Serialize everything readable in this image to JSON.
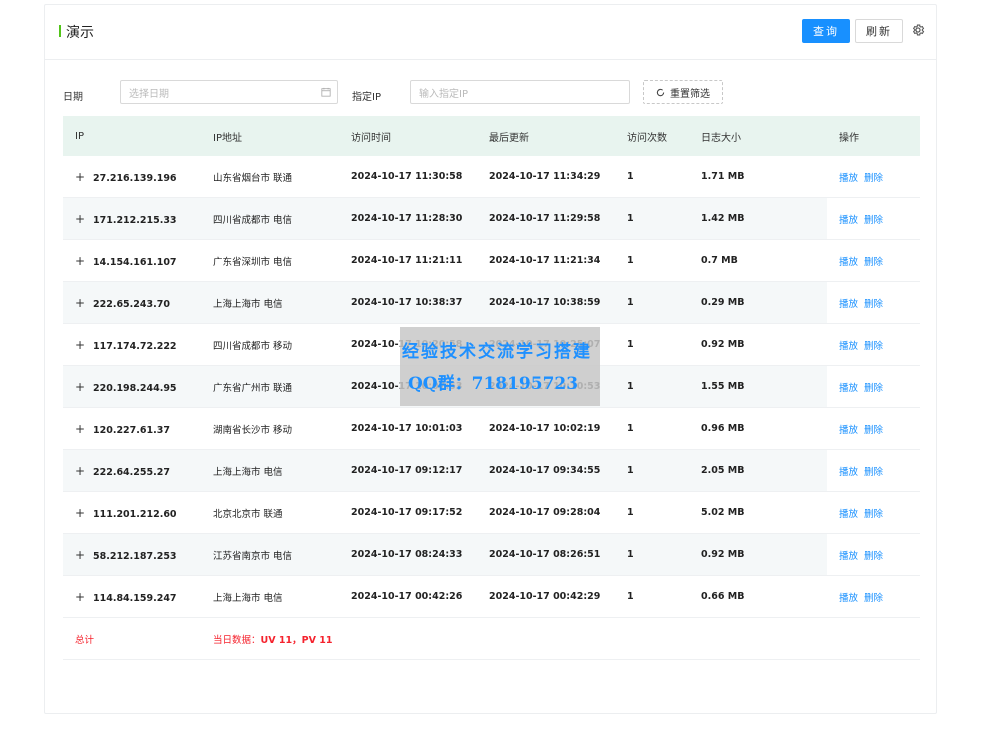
{
  "header": {
    "title": "演示",
    "query_label": "查询",
    "refresh_label": "刷新",
    "settings_icon": "gear-icon",
    "accent_color": "#52c41a",
    "primary_color": "#1890ff"
  },
  "filters": {
    "date_label": "日期",
    "date_placeholder": "选择日期",
    "ip_label": "指定IP",
    "ip_placeholder": "输入指定IP",
    "reset_label": "重置筛选"
  },
  "table": {
    "columns": [
      "IP",
      "IP地址",
      "访问时间",
      "最后更新",
      "访问次数",
      "日志大小",
      "操作"
    ],
    "rows": [
      {
        "ip": "27.216.139.196",
        "location": "山东省烟台市 联通",
        "visit_time": "2024-10-17 11:30:58",
        "last_update": "2024-10-17 11:34:29",
        "count": "1",
        "size": "1.71 MB"
      },
      {
        "ip": "171.212.215.33",
        "location": "四川省成都市 电信",
        "visit_time": "2024-10-17 11:28:30",
        "last_update": "2024-10-17 11:29:58",
        "count": "1",
        "size": "1.42 MB"
      },
      {
        "ip": "14.154.161.107",
        "location": "广东省深圳市 电信",
        "visit_time": "2024-10-17 11:21:11",
        "last_update": "2024-10-17 11:21:34",
        "count": "1",
        "size": "0.7 MB"
      },
      {
        "ip": "222.65.243.70",
        "location": "上海上海市 电信",
        "visit_time": "2024-10-17 10:38:37",
        "last_update": "2024-10-17 10:38:59",
        "count": "1",
        "size": "0.29 MB"
      },
      {
        "ip": "117.174.72.222",
        "location": "四川省成都市 移动",
        "visit_time": "2024-10-17 10:20:58",
        "last_update": "2024-10-17 10:25:07",
        "count": "1",
        "size": "0.92 MB"
      },
      {
        "ip": "220.198.244.95",
        "location": "广东省广州市 联通",
        "visit_time": "2024-10-17 10:07:53",
        "last_update": "2024-10-17 10:10:53",
        "count": "1",
        "size": "1.55 MB"
      },
      {
        "ip": "120.227.61.37",
        "location": "湖南省长沙市 移动",
        "visit_time": "2024-10-17 10:01:03",
        "last_update": "2024-10-17 10:02:19",
        "count": "1",
        "size": "0.96 MB"
      },
      {
        "ip": "222.64.255.27",
        "location": "上海上海市 电信",
        "visit_time": "2024-10-17 09:12:17",
        "last_update": "2024-10-17 09:34:55",
        "count": "1",
        "size": "2.05 MB"
      },
      {
        "ip": "111.201.212.60",
        "location": "北京北京市 联通",
        "visit_time": "2024-10-17 09:17:52",
        "last_update": "2024-10-17 09:28:04",
        "count": "1",
        "size": "5.02 MB"
      },
      {
        "ip": "58.212.187.253",
        "location": "江苏省南京市 电信",
        "visit_time": "2024-10-17 08:24:33",
        "last_update": "2024-10-17 08:26:51",
        "count": "1",
        "size": "0.92 MB"
      },
      {
        "ip": "114.84.159.247",
        "location": "上海上海市 电信",
        "visit_time": "2024-10-17 00:42:26",
        "last_update": "2024-10-17 00:42:29",
        "count": "1",
        "size": "0.66 MB"
      }
    ],
    "expand_symbol": "+",
    "play_label": "播放",
    "delete_label": "删除",
    "total_label": "总计",
    "summary_prefix": "当日数据：",
    "summary_values": "UV 11，PV 11"
  },
  "watermark": {
    "line1": "经验技术交流学习搭建",
    "line2": "QQ群：718195723"
  }
}
